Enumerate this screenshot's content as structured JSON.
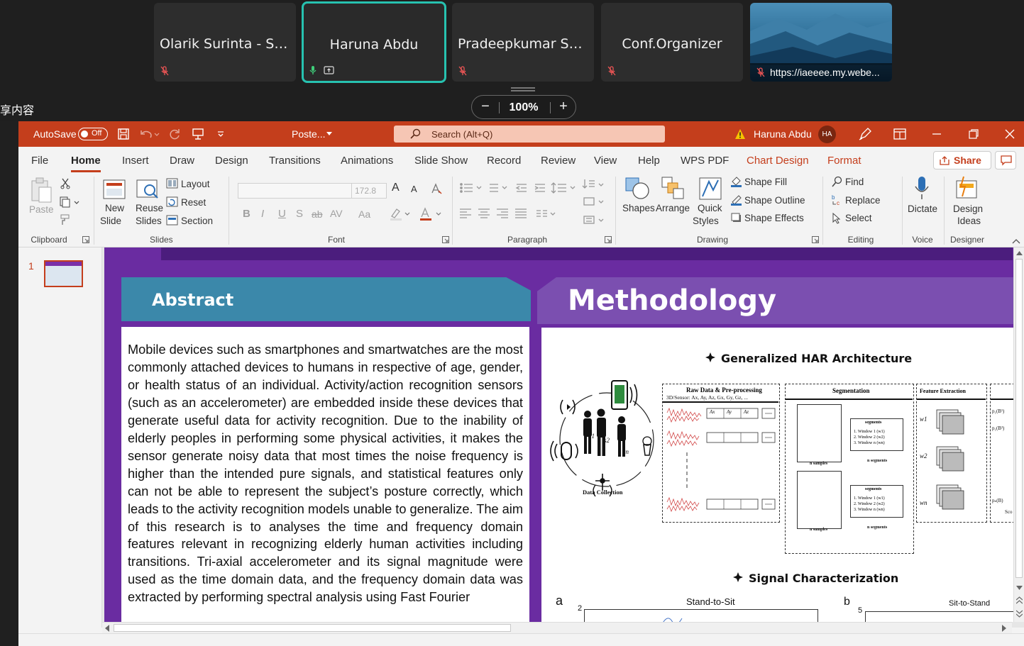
{
  "meeting": {
    "participants": [
      {
        "name": "Olarik Surinta - Ses...",
        "muted": true
      },
      {
        "name": "Haruna Abdu",
        "muted": false,
        "active": true
      },
      {
        "name": "Pradeepkumar Sury...",
        "muted": true
      },
      {
        "name": "Conf.Organizer",
        "muted": true
      },
      {
        "name": "https://iaeeee.my.webe...",
        "muted": true,
        "thumbnail": "mountain-landscape"
      }
    ],
    "zoom": {
      "minus": "−",
      "value": "100%",
      "plus": "+"
    },
    "share_label": "享内容"
  },
  "powerpoint": {
    "titlebar": {
      "autosave_label": "AutoSave",
      "autosave_state": "Off",
      "file_name": "Poste...",
      "search_placeholder": "Search (Alt+Q)",
      "user_name": "Haruna Abdu",
      "user_initials": "HA"
    },
    "tabs": [
      "File",
      "Home",
      "Insert",
      "Draw",
      "Design",
      "Transitions",
      "Animations",
      "Slide Show",
      "Record",
      "Review",
      "View",
      "Help",
      "WPS PDF",
      "Chart Design",
      "Format"
    ],
    "active_tab": "Home",
    "share_label": "Share",
    "ribbon": {
      "clipboard": {
        "paste": "Paste",
        "group": "Clipboard"
      },
      "slides": {
        "new_slide_1": "New",
        "new_slide_2": "Slide",
        "reuse_1": "Reuse",
        "reuse_2": "Slides",
        "layout": "Layout",
        "reset": "Reset",
        "section": "Section",
        "group": "Slides"
      },
      "font": {
        "size": "172.8",
        "bold": "B",
        "italic": "I",
        "underline": "U",
        "shadow": "S",
        "strike": "ab",
        "spacing": "AV",
        "case": "Aa",
        "grow": "A",
        "shrink": "A",
        "group": "Font"
      },
      "paragraph": {
        "group": "Paragraph"
      },
      "drawing": {
        "shapes": "Shapes",
        "arrange": "Arrange",
        "quick_styles_1": "Quick",
        "quick_styles_2": "Styles",
        "shape_fill": "Shape Fill",
        "shape_outline": "Shape Outline",
        "shape_effects": "Shape Effects",
        "group": "Drawing"
      },
      "editing": {
        "find": "Find",
        "replace": "Replace",
        "select": "Select",
        "group": "Editing"
      },
      "voice": {
        "dictate": "Dictate",
        "group": "Voice"
      },
      "designer": {
        "ideas_1": "Design",
        "ideas_2": "Ideas",
        "group": "Designer"
      }
    },
    "thumb_number": "1",
    "slide": {
      "abstract_title": "Abstract",
      "abstract_text": "Mobile devices such as smartphones and smartwatches are the most commonly attached devices to humans in respective of age, gender, or health status of an individual. Activity/action recognition sensors (such as an accelerometer) are embedded inside these devices that generate useful data for activity recognition. Due to the inability of elderly peoples in performing some physical activities, it makes the sensor generate noisy data that most times the noise frequency is higher than the intended pure signals, and statistical features only can not be able to represent the subject’s posture correctly, which leads to the activity recognition models unable to generalize. The aim of this research is to analyses the time and frequency domain features relevant in recognizing elderly human activities including transitions. Tri-axial accelerometer and its signal magnitude were used as the time domain data, and the frequency domain data was extracted by performing spectral analysis using Fast Fourier",
      "methodology_title": "Methodology",
      "har_heading": "Generalized HAR Architecture",
      "signal_heading": "Signal Characterization",
      "diagram": {
        "data_collection": "Data Collection",
        "s1": "s1",
        "s2": "s2",
        "sn": "sn",
        "raw_title": "Raw Data & Pre-processing",
        "raw_sub": "3D/Sensor: Ax, Ay, Az, Gx, Gy, Gz, ...",
        "ax": "Ax",
        "ay": "Ay",
        "az": "Az",
        "seg_title": "Segmentation",
        "segments": "segments",
        "n_samples": "n samples",
        "n_segments": "n segments",
        "windows": [
          "1. Window 1 (w1)",
          "2. Window 2 (w2)",
          "3. Window n (wn)"
        ],
        "feat_title": "Feature Extraction",
        "w1": "w1",
        "w2": "w2",
        "wn": "wn",
        "p1": "p₁(B¹)",
        "p2": "p₁(B²)",
        "pn": "pₙ(B)",
        "sco": "Sco"
      },
      "signal_chart": {
        "panel_a": "a",
        "panel_b": "b",
        "title_a": "Stand-to-Sit",
        "title_b": "Sit-to-Stand",
        "ytick_a": "2",
        "ytick_b": "5"
      }
    }
  }
}
